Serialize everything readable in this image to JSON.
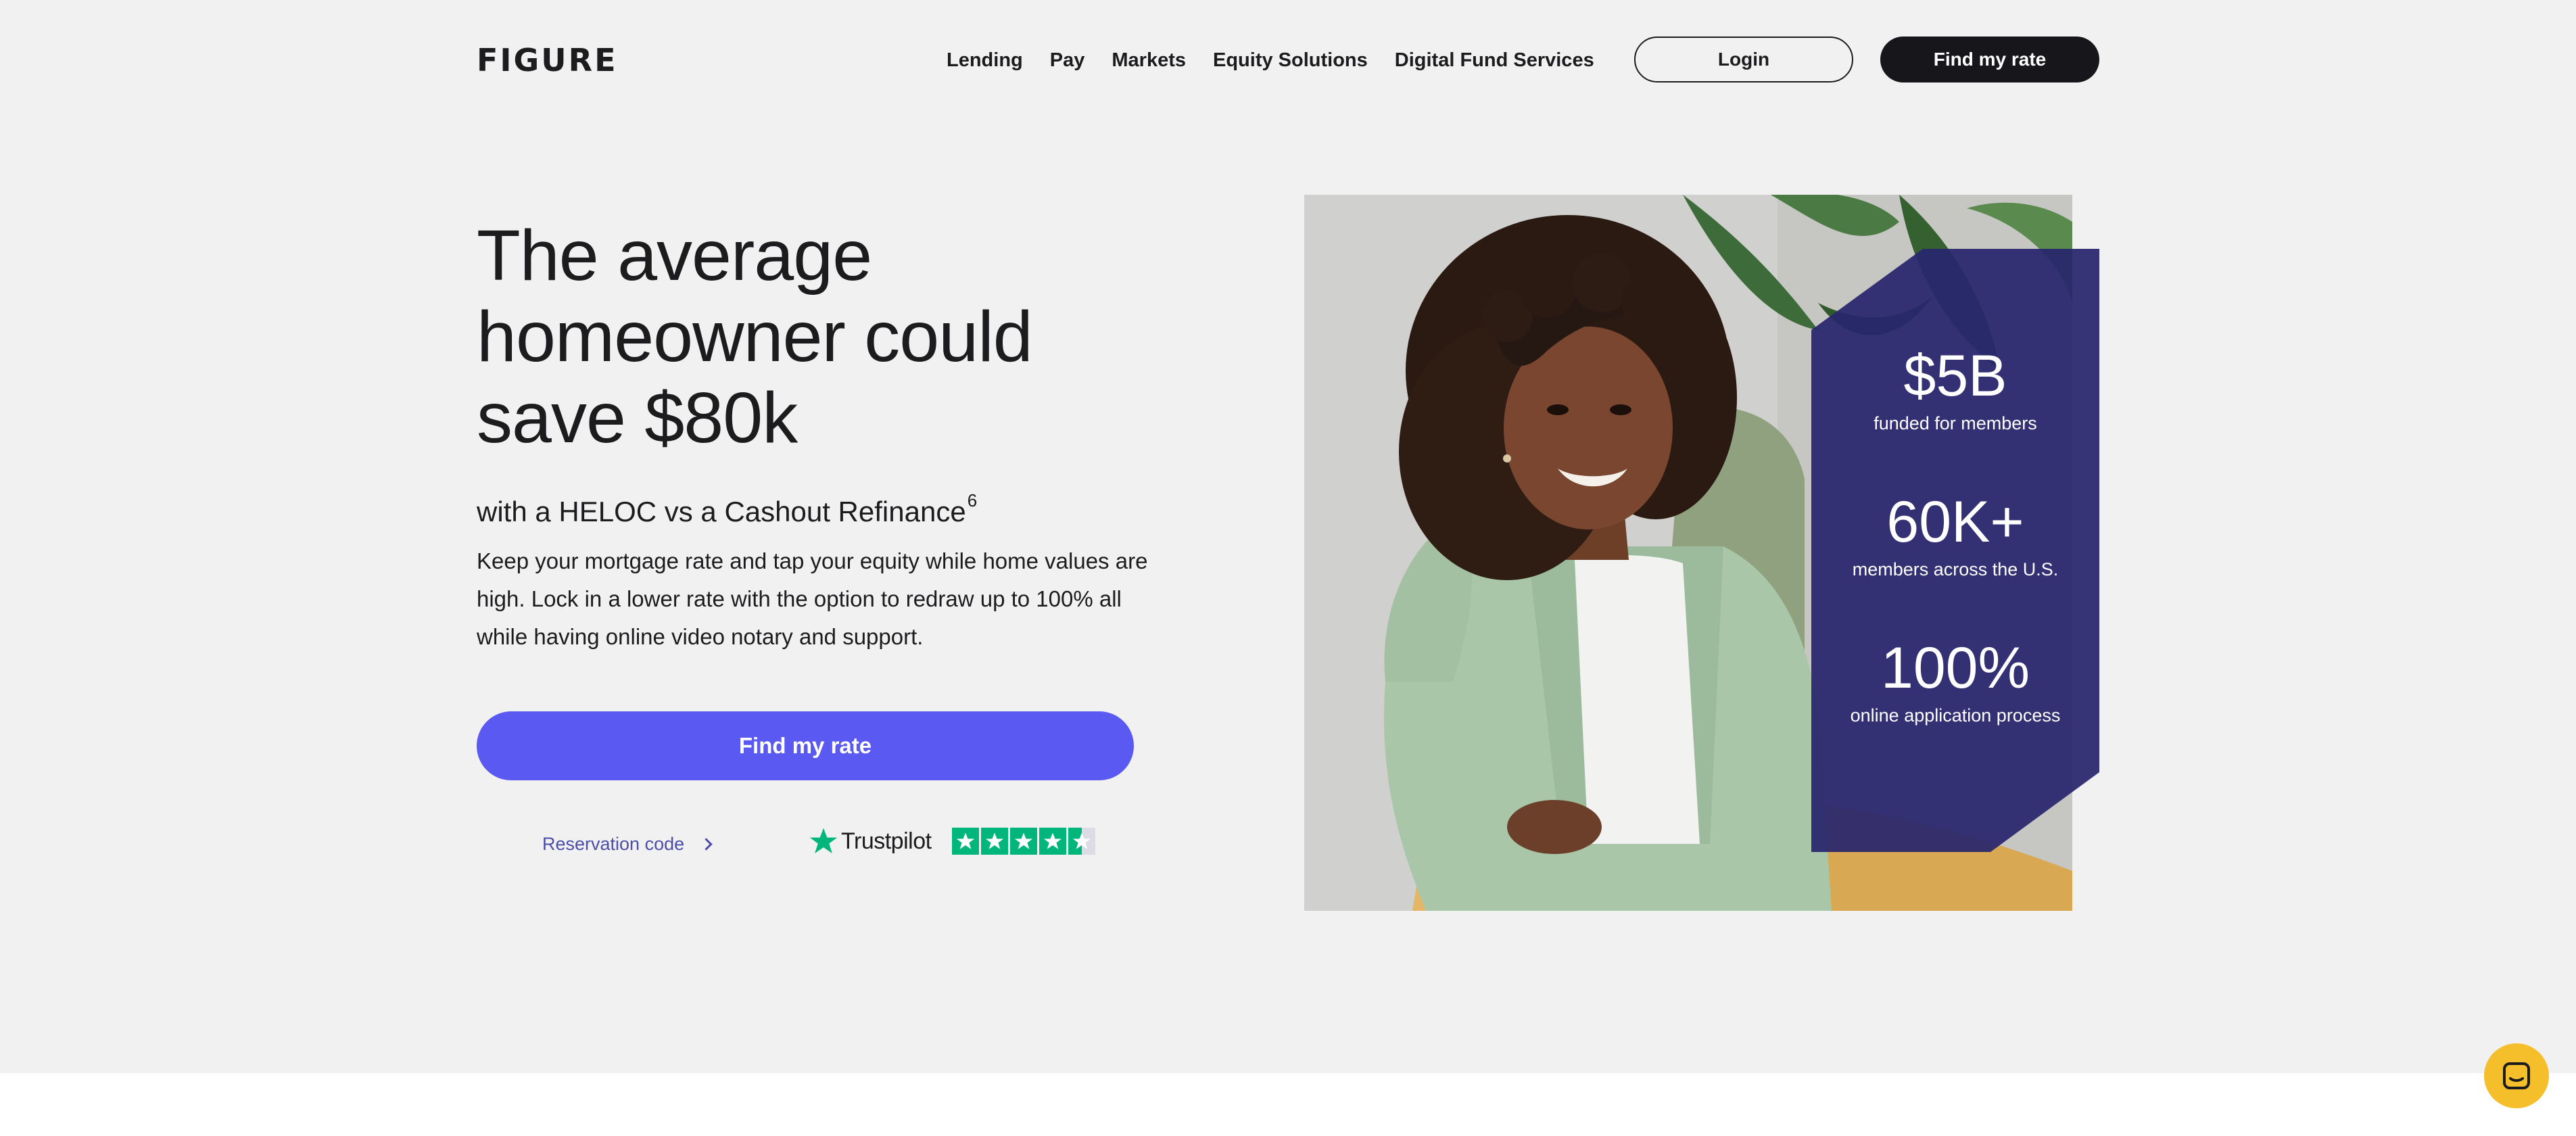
{
  "header": {
    "logo_text": "FIGURE",
    "nav": [
      "Lending",
      "Pay",
      "Markets",
      "Equity Solutions",
      "Digital Fund Services"
    ],
    "login_label": "Login",
    "find_rate_label": "Find my rate"
  },
  "hero": {
    "headline_lines": [
      "The average",
      "homeowner could",
      "save $80k"
    ],
    "subhead": "with a HELOC vs a Cashout Refinance",
    "subhead_footnote": "6",
    "body": "Keep your mortgage rate and tap your equity while home values are high. Lock in a lower rate with the option to redraw up to 100% all while having online video notary and support.",
    "cta_label": "Find my rate",
    "reservation_label": "Reservation code",
    "trustpilot_label": "Trustpilot",
    "trustpilot_rating": 4.5
  },
  "stats": [
    {
      "value": "$5B",
      "label": "funded for members"
    },
    {
      "value": "60K+",
      "label": "members across the U.S."
    },
    {
      "value": "100%",
      "label": "online application process"
    }
  ],
  "colors": {
    "background": "#f1f1f1",
    "primary_button": "#5a5af2",
    "dark_button": "#16161b",
    "stats_panel": "#28266e",
    "trustpilot_green": "#00b67a",
    "chat_button": "#f5be2b",
    "link": "#4d4dab"
  },
  "icons": {
    "reservation": "chevron-right-icon",
    "trustpilot": "trustpilot-star-icon",
    "chat": "chat-icon"
  }
}
